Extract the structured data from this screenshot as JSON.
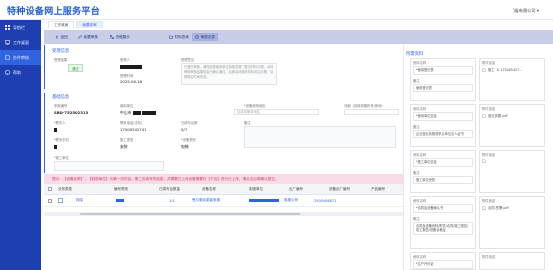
{
  "header": {
    "title": "特种设备网上服务平台",
    "company": "]省有限公司 ▾"
  },
  "sidebar": {
    "items": [
      {
        "label": "导航栏",
        "icon": "grid-icon"
      },
      {
        "label": "工作桌面",
        "icon": "desktop-icon"
      },
      {
        "label": "办件审核",
        "icon": "document-icon"
      },
      {
        "label": "帮助",
        "icon": "help-icon"
      }
    ]
  },
  "tabs": [
    {
      "label": "工作桌面"
    },
    {
      "label": "我要评审"
    }
  ],
  "toolbar": {
    "back": "返回",
    "review": "我要审核",
    "flow": "流程展示",
    "materials": "材料查询",
    "opinion": "审核记录"
  },
  "applicant": {
    "section_title": "受理信息",
    "fields": {
      "accept_result_label": "受理结果",
      "accept_result_value": "通过",
      "acceptor_label": "受理人",
      "acceptor_value": "",
      "opinion_label": "受理意见",
      "opinion_value": "已通过审核，通知经营使用单位到相关部门提交材料办理，对待审核审核结果信息已确认通过，后续请持相关材料前往办理，请按规定时间完成。",
      "date_label": "受理时间",
      "date_value": "2025-06-18"
    }
  },
  "device": {
    "section_title": "基础信息",
    "fields": {
      "code_label": "申报编号",
      "code_value": "SBD-752502313",
      "unit_label": "使用单位",
      "unit_value": "中山市",
      "place_label": "*设备使用地区",
      "place_placeholder": "请选择使用地区",
      "detail_label": "详细（具体到楼栋号/房间）",
      "contact_label": "*联系人",
      "contact_value": "",
      "phone_label": "联系电话(手机)",
      "phone_value": "17500542741",
      "count_label": "已填写台数",
      "count_value": "0/7",
      "remark_label": "备注",
      "mobile_label": "*联系手机",
      "mobile_value": "",
      "type_label": "施工类型",
      "type_value": "安装",
      "category_label": "*设备类别",
      "category_value": "电梯",
      "team_label": "*施工单位"
    }
  },
  "warning": "提示：【设备名称】、【制造单位】为第一页内容，第二页填写的信息，并需要已上传设备需要在【下页】进行已上传，请点击后再确认提交。",
  "table": {
    "headers": [
      "业务类型",
      "编号类别",
      "已填写台数量",
      "设备名称",
      "制造单位",
      "出厂编号",
      "设备出厂编号",
      "产品编号"
    ],
    "rows": [
      [
        "拆除",
        "",
        "1/1",
        "曳引驱动乘客电梯",
        "",
        "电梯公司",
        "2500406871",
        ""
      ]
    ]
  },
  "materials": {
    "title": "所需资料",
    "col_name_label": "资料名称",
    "col_file_label": "附件信息",
    "items": [
      {
        "name": "*使用登记表",
        "note": "使用登记表",
        "file": "施工",
        "file_extra": "& 175005427..."
      },
      {
        "name": "*使用单位信息",
        "note": "企业营业执照或事业单位法人证书",
        "file": "营业执照.pdf",
        "file_extra": ""
      },
      {
        "name": "*施工单位信息",
        "note": "施工单位资质",
        "file": "",
        "file_extra": ""
      },
      {
        "name": "*合同及设备确认书",
        "note": "合同及设备资料/附件/合同/施工报告/竣工报告/设备合格证",
        "file": "合同.签署.pdf",
        "file_extra": ""
      },
      {
        "name": "*生产许可证",
        "note": "",
        "file": "",
        "file_extra": ""
      }
    ]
  }
}
